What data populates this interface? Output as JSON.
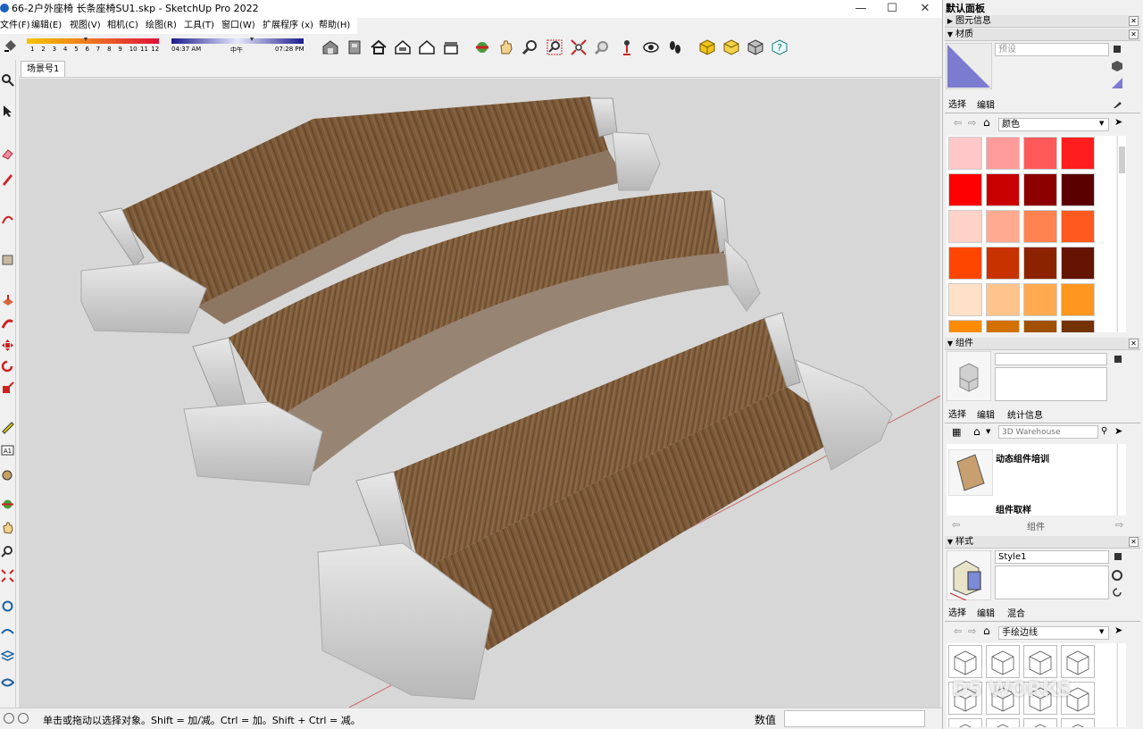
{
  "window": {
    "title": "66-2户外座椅 长条座椅SU1.skp - SketchUp Pro 2022"
  },
  "menu": [
    "文件(F)",
    "编辑(E)",
    "视图(V)",
    "相机(C)",
    "绘图(R)",
    "工具(T)",
    "窗口(W)",
    "扩展程序 (x)",
    "帮助(H)"
  ],
  "shadow_slider": {
    "months": [
      "1",
      "2",
      "3",
      "4",
      "5",
      "6",
      "7",
      "8",
      "9",
      "10",
      "11",
      "12"
    ],
    "time_start": "04:37 AM",
    "time_mid": "中午",
    "time_end": "07:28 PM"
  },
  "scene_tab": "场景号1",
  "status": {
    "hint": "单击或拖动以选择对象。Shift = 加/减。Ctrl = 加。Shift + Ctrl = 减。",
    "value_label": "数值",
    "value": ""
  },
  "panel": {
    "title": "默认面板",
    "entity_info": "图元信息",
    "materials": {
      "title": "材质",
      "name_placeholder": "预设",
      "tabs": [
        "选择",
        "编辑"
      ],
      "category": "颜色",
      "swatches": [
        "#ffc8c8",
        "#ff9b9b",
        "#ff5a5a",
        "#ff1e1e",
        "#ff0000",
        "#c80000",
        "#8c0000",
        "#5a0000",
        "#ffd2c8",
        "#ffaa91",
        "#ff8250",
        "#ff5a1e",
        "#ff4600",
        "#c83200",
        "#8c2300",
        "#641400",
        "#ffe1c8",
        "#ffc38c",
        "#ffaa50",
        "#ff961e",
        "#ff8c00",
        "#d27000",
        "#a05000",
        "#733200"
      ]
    },
    "components": {
      "title": "组件",
      "tabs": [
        "选择",
        "编辑",
        "统计信息"
      ],
      "search_placeholder": "3D Warehouse",
      "items": [
        "动态组件培训",
        "组件取样"
      ],
      "footer": "组件"
    },
    "styles": {
      "title": "样式",
      "style_name": "Style1",
      "tabs": [
        "选择",
        "编辑",
        "混合"
      ],
      "category": "手绘边线"
    },
    "watermark": "D5 WORKS"
  }
}
